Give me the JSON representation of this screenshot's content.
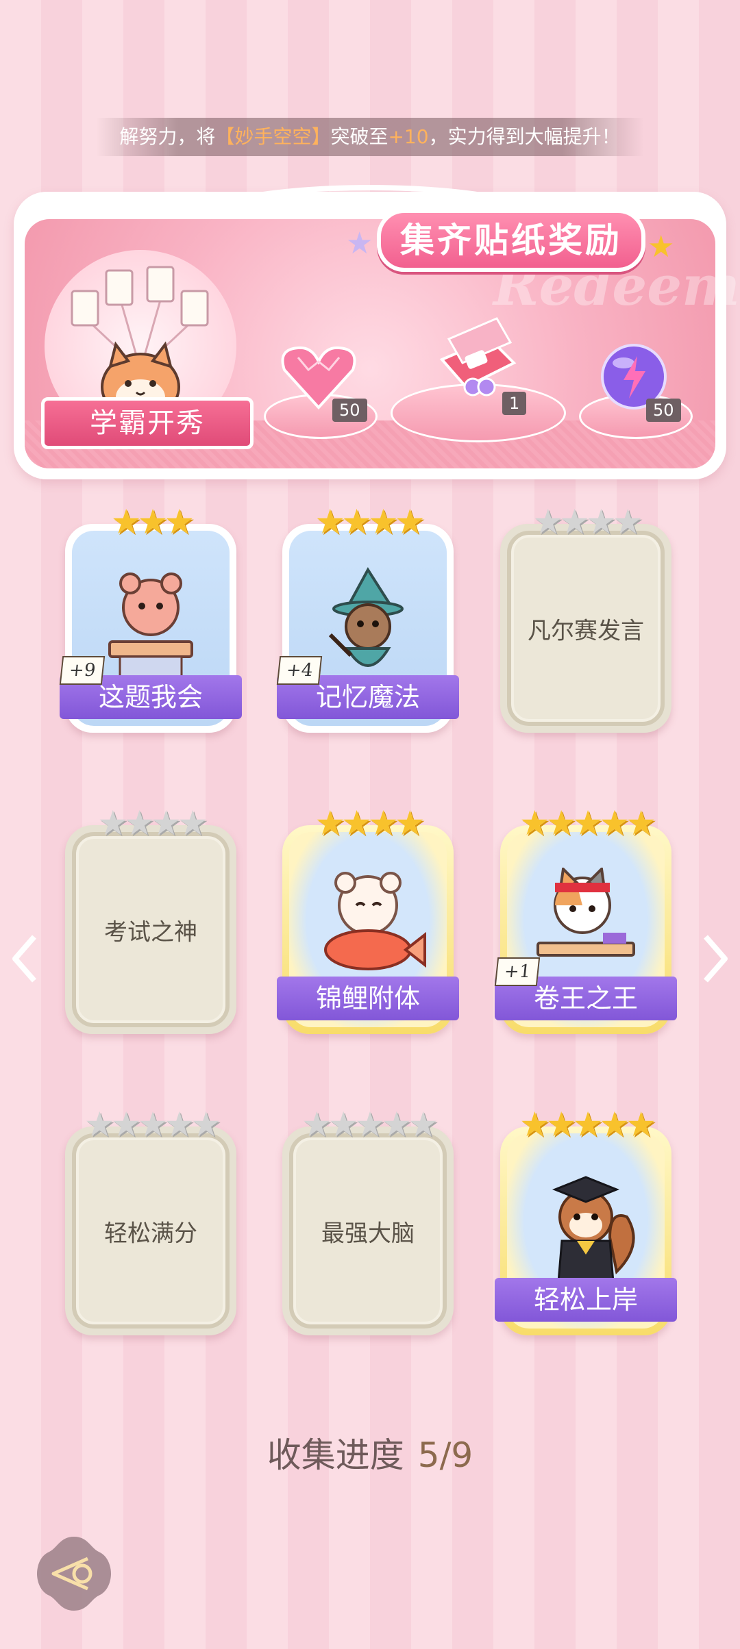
{
  "top_message": {
    "prefix": "解努力，将",
    "highlight": "【妙手空空】",
    "middle": "突破至",
    "level": "+10",
    "suffix": "，实力得到大幅提升！"
  },
  "reward_panel": {
    "title": "集齐贴纸奖励",
    "watermark": "Redeem",
    "mascot_label": "学霸开秀",
    "rewards": [
      {
        "icon": "pink-heart-gem-icon",
        "qty": "50"
      },
      {
        "icon": "gift-box-icon",
        "qty": "1"
      },
      {
        "icon": "purple-lightning-orb-icon",
        "qty": "50"
      }
    ]
  },
  "cards": [
    {
      "name": "这题我会",
      "state": "unlocked",
      "stars": 3,
      "max_stars": 3,
      "level": "+9",
      "char": "bear-at-desk-icon"
    },
    {
      "name": "记忆魔法",
      "state": "unlocked",
      "stars": 4,
      "max_stars": 4,
      "level": "+4",
      "char": "otter-wizard-icon"
    },
    {
      "name": "凡尔赛发言",
      "state": "locked",
      "stars": 0,
      "max_stars": 4,
      "level": "",
      "char": ""
    },
    {
      "name": "考试之神",
      "state": "locked",
      "stars": 0,
      "max_stars": 4,
      "level": "",
      "char": ""
    },
    {
      "name": "锦鲤附体",
      "state": "gold",
      "stars": 4,
      "max_stars": 4,
      "level": "",
      "char": "bear-with-koi-icon"
    },
    {
      "name": "卷王之王",
      "state": "gold",
      "stars": 5,
      "max_stars": 5,
      "level": "+1",
      "char": "cat-studying-icon"
    },
    {
      "name": "轻松满分",
      "state": "locked",
      "stars": 0,
      "max_stars": 5,
      "level": "",
      "char": ""
    },
    {
      "name": "最强大脑",
      "state": "locked",
      "stars": 0,
      "max_stars": 5,
      "level": "",
      "char": ""
    },
    {
      "name": "轻松上岸",
      "state": "gold",
      "stars": 5,
      "max_stars": 5,
      "level": "",
      "char": "squirrel-graduate-icon"
    }
  ],
  "progress": {
    "label": "收集进度",
    "value": "5/9"
  },
  "colors": {
    "accent": "#8257d8",
    "gold_star": "#f8c22c",
    "pink": "#f2608f"
  }
}
